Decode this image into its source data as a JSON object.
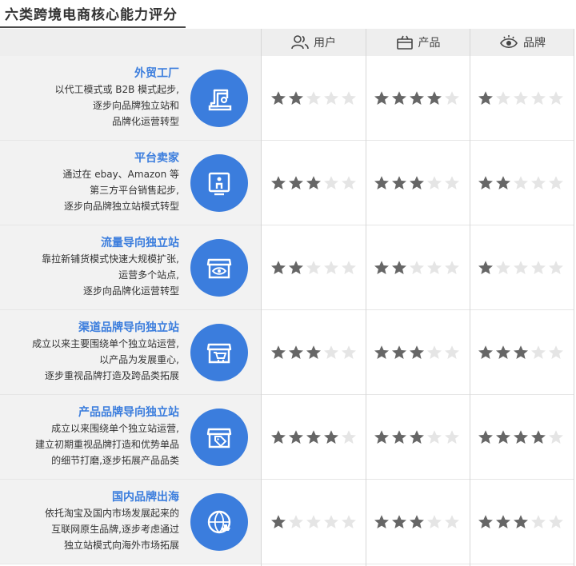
{
  "title": "六类跨境电商核心能力评分",
  "headers": [
    {
      "label": "用户",
      "icon": "users-icon"
    },
    {
      "label": "产品",
      "icon": "box-icon"
    },
    {
      "label": "品牌",
      "icon": "eye-icon"
    }
  ],
  "colors": {
    "accent": "#3b7ddd",
    "star_on": "#666666",
    "star_off": "#e5e5e5"
  },
  "rows": [
    {
      "name": "外贸工厂",
      "lines": [
        "以代工模式或 B2B 模式起步,",
        "逐步向品牌独立站和",
        "品牌化运营转型"
      ],
      "icon": "sewing-machine-icon",
      "ratings": [
        2,
        4,
        1
      ]
    },
    {
      "name": "平台卖家",
      "lines": [
        "通过在 ebay、Amazon 等",
        "第三方平台销售起步,",
        "逐步向品牌独立站模式转型"
      ],
      "icon": "monitor-user-icon",
      "ratings": [
        3,
        3,
        2
      ]
    },
    {
      "name": "流量导向独立站",
      "lines": [
        "靠拉新铺货模式快速大规模扩张,",
        "运营多个站点,",
        "逐步向品牌化运营转型"
      ],
      "icon": "store-eye-icon",
      "ratings": [
        2,
        2,
        1
      ]
    },
    {
      "name": "渠道品牌导向独立站",
      "lines": [
        "成立以来主要围绕单个独立站运营,",
        "以产品为发展重心,",
        "逐步重视品牌打造及跨品类拓展"
      ],
      "icon": "store-cart-icon",
      "ratings": [
        3,
        3,
        3
      ]
    },
    {
      "name": "产品品牌导向独立站",
      "lines": [
        "成立以来围绕单个独立站运营,",
        "建立初期重视品牌打造和优势单品",
        "的细节打磨,逐步拓展产品品类"
      ],
      "icon": "store-tag-icon",
      "ratings": [
        4,
        3,
        4
      ]
    },
    {
      "name": "国内品牌出海",
      "lines": [
        "依托淘宝及国内市场发展起来的",
        "互联网原生品牌,逐步考虑通过",
        "独立站模式向海外市场拓展"
      ],
      "icon": "globe-ship-icon",
      "ratings": [
        1,
        3,
        3
      ]
    }
  ]
}
